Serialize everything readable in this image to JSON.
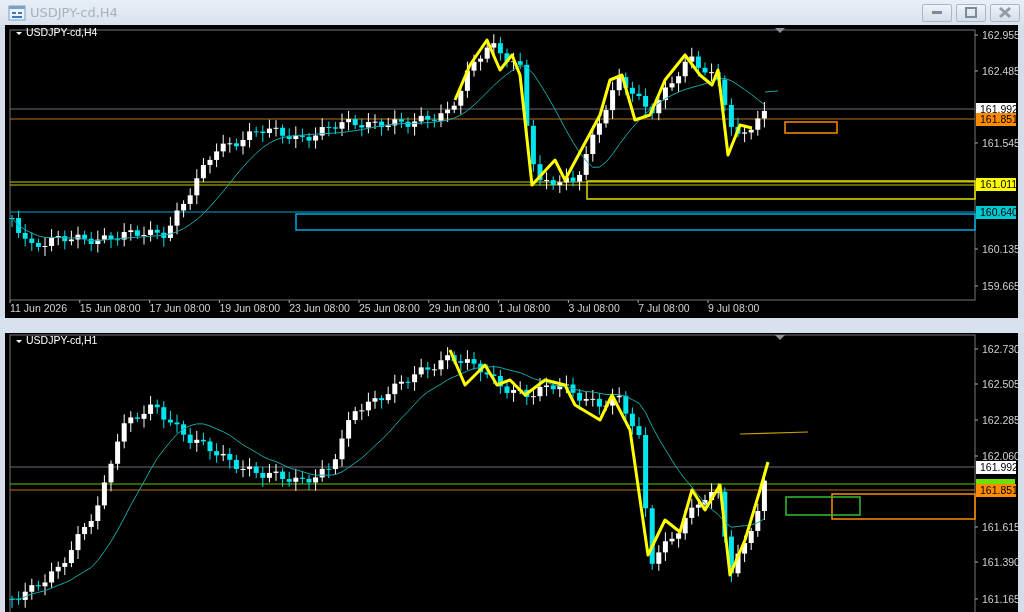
{
  "windows": [
    {
      "title": "USDJPY-cd,H4",
      "chart_label": "USDJPY-cd,H4",
      "price_axis": [
        {
          "text": "162.955"
        },
        {
          "text": "162.485"
        },
        {
          "text": "161.545"
        },
        {
          "text": "160.135"
        },
        {
          "text": "159.665"
        }
      ],
      "price_tags": [
        {
          "text": "161.992",
          "color": "#ffffff"
        },
        {
          "text": "161.851",
          "color": "#ff8c00"
        },
        {
          "text": "161.011",
          "color": "#ffff00"
        },
        {
          "text": "160.640",
          "color": "#00c8d0"
        }
      ],
      "time_axis": [
        "11 Jun 2026",
        "15 Jun 08:00",
        "17 Jun 08:00",
        "19 Jun 08:00",
        "23 Jun 08:00",
        "25 Jun 08:00",
        "29 Jun 08:00",
        "1 Jul 08:00",
        "3 Jul 08:00",
        "7 Jul 08:00",
        "9 Jul 08:00"
      ]
    },
    {
      "chart_label": "USDJPY-cd,H1",
      "price_axis": [
        {
          "text": "162.730"
        },
        {
          "text": "162.505"
        },
        {
          "text": "162.285"
        },
        {
          "text": "162.060"
        },
        {
          "text": "161.615"
        },
        {
          "text": "161.390"
        },
        {
          "text": "161.165"
        }
      ],
      "price_tags": [
        {
          "text": "161.992",
          "color": "#ffffff"
        },
        {
          "text": "161.851",
          "color": "#ff8c00"
        }
      ]
    }
  ]
}
